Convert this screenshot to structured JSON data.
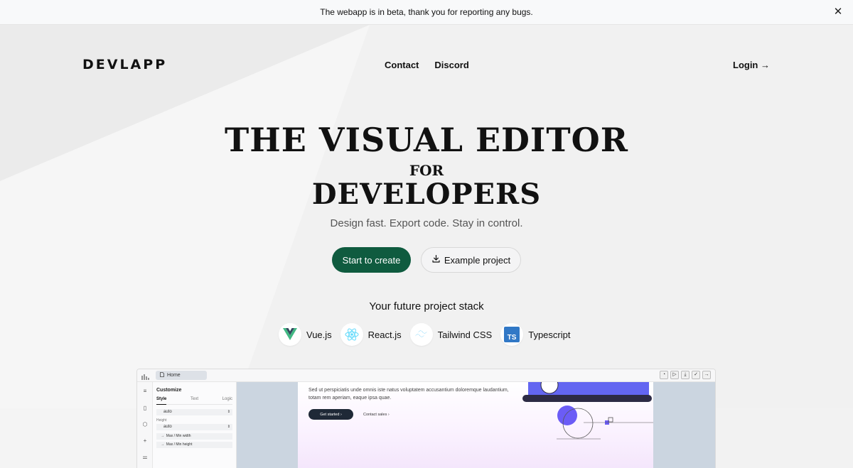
{
  "banner": {
    "message": "The webapp is in beta, thank you for reporting any bugs.",
    "close_glyph": "✕"
  },
  "header": {
    "logo": "DEVLAPP",
    "nav": [
      "Contact",
      "Discord"
    ],
    "login": "Login →"
  },
  "hero": {
    "title_line1": "The visual editor",
    "title_line2": "for",
    "title_line3": "developers",
    "subtitle": "Design fast. Export code. Stay in control.",
    "primary_cta": "Start to create",
    "secondary_cta": "Example project",
    "primary_color": "#0f5b3f"
  },
  "stack": {
    "title": "Your future project stack",
    "items": [
      {
        "label": "Vue.js",
        "icon": "vue-icon"
      },
      {
        "label": "React.js",
        "icon": "react-icon"
      },
      {
        "label": "Tailwind CSS",
        "icon": "tailwind-icon"
      },
      {
        "label": "Typescript",
        "icon": "typescript-icon"
      }
    ]
  },
  "preview": {
    "home_tab": "Home",
    "panel_title": "Customize",
    "tabs": [
      "Style",
      "Text",
      "Logic"
    ],
    "field_auto_1": "auto",
    "height_label": "Height",
    "field_auto_2": "auto",
    "max_min_width": "Max / Min width",
    "max_min_height": "Max / Min height",
    "canvas_text": "Sed ut perspiciatis unde omnis iste natus voluptatem accusantium doloremque laudantium, totam rem aperiam, eaque ipsa quae.",
    "get_started": "Get started",
    "contact_sales": "Contact sales"
  }
}
